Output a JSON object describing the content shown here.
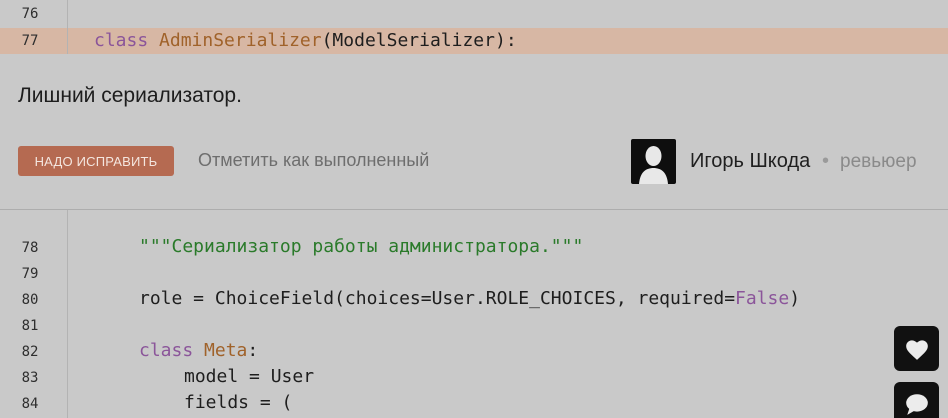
{
  "code_lines": {
    "l76": {
      "num": "76",
      "text": ""
    },
    "l77": {
      "num": "77",
      "kw": "class",
      "name": "AdminSerializer",
      "rest": "(ModelSerializer):"
    },
    "l78": {
      "num": "78",
      "str": "\"\"\"Сериализатор работы администратора.\"\"\""
    },
    "l79": {
      "num": "79",
      "text": ""
    },
    "l80": {
      "num": "80",
      "pre": "role = ChoiceField(choices=User.ROLE_CHOICES, required=",
      "kw": "False",
      "post": ")"
    },
    "l81": {
      "num": "81",
      "text": ""
    },
    "l82": {
      "num": "82",
      "kw": "class",
      "name": "Meta",
      "rest": ":"
    },
    "l83": {
      "num": "83",
      "text": "model = User"
    },
    "l84": {
      "num": "84",
      "text": "fields = ("
    }
  },
  "comment": {
    "text": "Лишний сериализатор.",
    "fix_button": "НАДО ИСПРАВИТЬ",
    "mark_done": "Отметить как выполненный",
    "author": "Игорь Шкода",
    "separator": "•",
    "role": "ревьюер"
  },
  "side_buttons": {
    "like_icon": "heart-icon",
    "chat_icon": "chat-icon"
  },
  "colors": {
    "fix_button": "#b56a51",
    "highlight": "#d7b7a4",
    "keyword": "#8b559a",
    "string": "#2a7a2a"
  }
}
